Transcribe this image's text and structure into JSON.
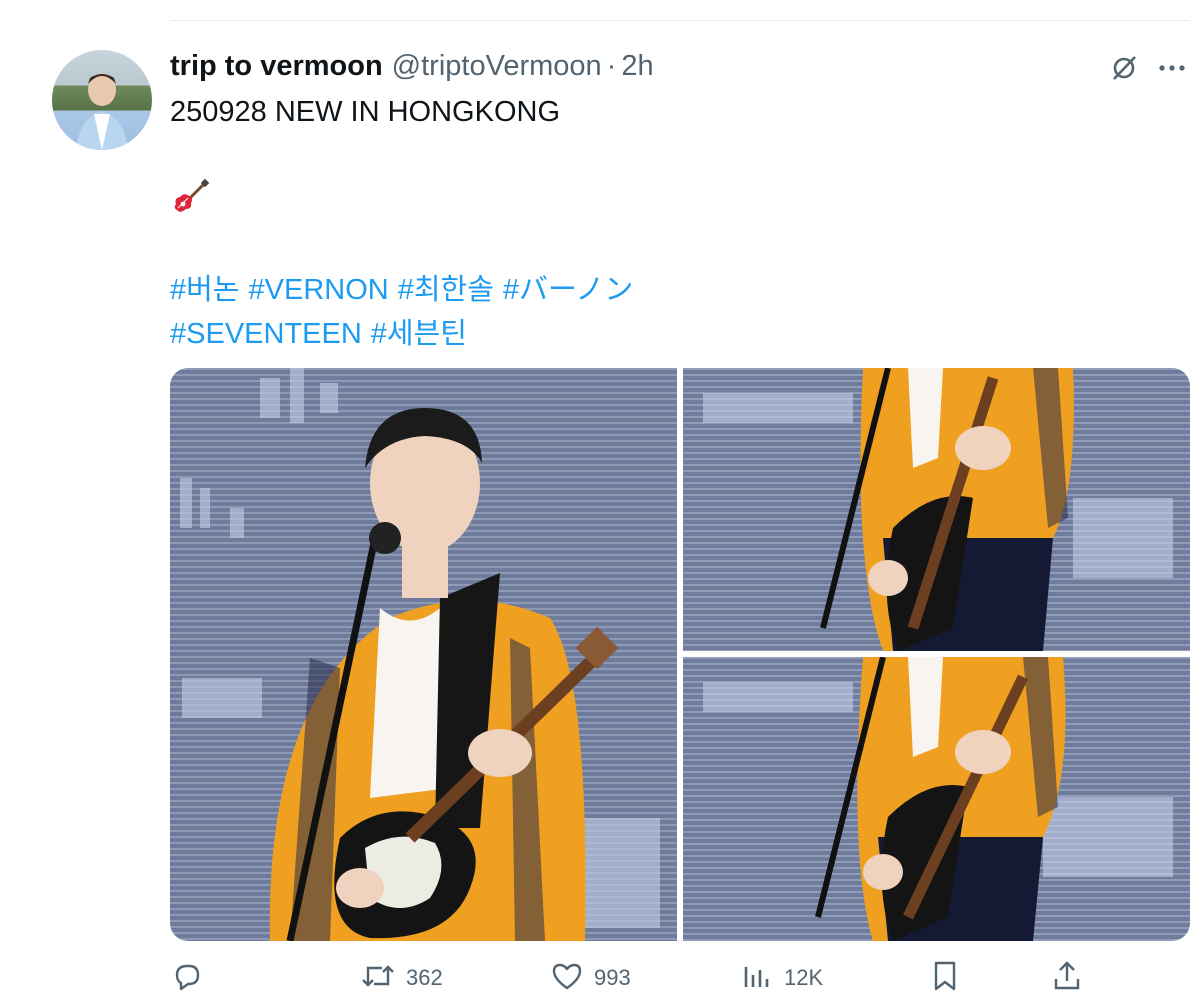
{
  "tweet": {
    "author_name": "trip to vermoon",
    "handle": "@triptoVermoon",
    "separator": "·",
    "time": "2h",
    "line1": "250928 NEW IN HONGKONG",
    "emoji": "🎸",
    "hashtags_line1": [
      "#버논",
      "#VERNON",
      "#최한솔",
      "#バーノン"
    ],
    "hashtags_line2": [
      "#SEVENTEEN",
      "#세븐틴"
    ]
  },
  "actions": {
    "replies": "",
    "reposts": "362",
    "likes": "993",
    "views": "12K"
  },
  "icons": {
    "grok": "grok-icon",
    "more": "more-icon",
    "reply": "reply-icon",
    "repost": "repost-icon",
    "like": "heart-icon",
    "views": "views-icon",
    "bookmark": "bookmark-icon",
    "share": "share-icon"
  },
  "colors": {
    "link": "#1d9bf0",
    "secondary_text": "#536471",
    "jacket": "#f0a020",
    "stage_screen": "#6f7c9c"
  }
}
